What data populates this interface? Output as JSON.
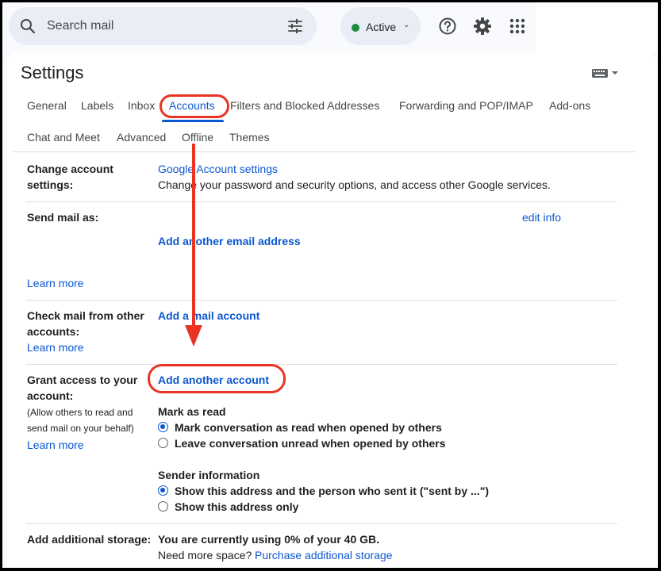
{
  "search": {
    "placeholder": "Search mail"
  },
  "status": {
    "label": "Active"
  },
  "page": {
    "title": "Settings"
  },
  "tabs": [
    {
      "label": "General"
    },
    {
      "label": "Labels"
    },
    {
      "label": "Inbox"
    },
    {
      "label": "Accounts",
      "active": true
    },
    {
      "label": "Filters and Blocked Addresses"
    },
    {
      "label": "Forwarding and POP/IMAP"
    },
    {
      "label": "Add-ons"
    },
    {
      "label": "Chat and Meet"
    },
    {
      "label": "Advanced"
    },
    {
      "label": "Offline"
    },
    {
      "label": "Themes"
    }
  ],
  "rows": {
    "change_account": {
      "label": "Change account settings:",
      "link": "Google Account settings",
      "desc": "Change your password and security options, and access other Google services."
    },
    "send_mail": {
      "label": "Send mail as:",
      "edit_info": "edit info",
      "add_email": "Add another email address",
      "learn_more": "Learn more"
    },
    "check_mail": {
      "label": "Check mail from other accounts:",
      "add_account": "Add a mail account",
      "learn_more": "Learn more"
    },
    "grant_access": {
      "label": "Grant access to your account:",
      "note": "(Allow others to read and send mail on your behalf)",
      "learn_more": "Learn more",
      "add_account": "Add another account",
      "mark_read_heading": "Mark as read",
      "mark_read_options": [
        "Mark conversation as read when opened by others",
        "Leave conversation unread when opened by others"
      ],
      "sender_info_heading": "Sender information",
      "sender_info_options": [
        "Show this address and the person who sent it (\"sent by ...\")",
        "Show this address only"
      ]
    },
    "storage": {
      "label": "Add additional storage:",
      "usage": "You are currently using 0% of your 40 GB.",
      "need_more": "Need more space?",
      "purchase": "Purchase additional storage"
    }
  },
  "colors": {
    "accent": "#0b57d0",
    "annotation": "#ea3323",
    "status_green": "#1e8e3e"
  },
  "icons": [
    "search-icon",
    "tune-icon",
    "chevron-down-icon",
    "help-icon",
    "gear-icon",
    "apps-grid-icon",
    "keyboard-icon"
  ]
}
